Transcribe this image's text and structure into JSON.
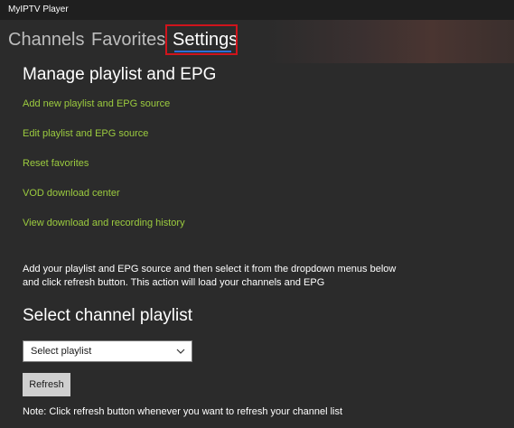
{
  "window": {
    "title": "MyIPTV Player"
  },
  "tabs": [
    {
      "label": "Channels"
    },
    {
      "label": "Favorites"
    },
    {
      "label": "Settings",
      "selected": true
    }
  ],
  "colors": {
    "accent": "#2e6fd8",
    "link": "#9ccc3f",
    "highlight": "#d0141c",
    "background": "#2b2b2b"
  },
  "manage": {
    "title": "Manage playlist and EPG",
    "links": [
      {
        "label": "Add new playlist and EPG source"
      },
      {
        "label": "Edit playlist and EPG source"
      },
      {
        "label": "Reset favorites"
      },
      {
        "label": "VOD download center"
      },
      {
        "label": "View download and recording history"
      }
    ],
    "info": "Add your playlist and EPG source and then select it from the dropdown menus below and click refresh button. This action will load your channels and EPG"
  },
  "select": {
    "title": "Select channel playlist",
    "dropdown_value": "Select playlist",
    "refresh_label": "Refresh",
    "note": "Note: Click refresh button whenever you want to refresh your channel list"
  }
}
